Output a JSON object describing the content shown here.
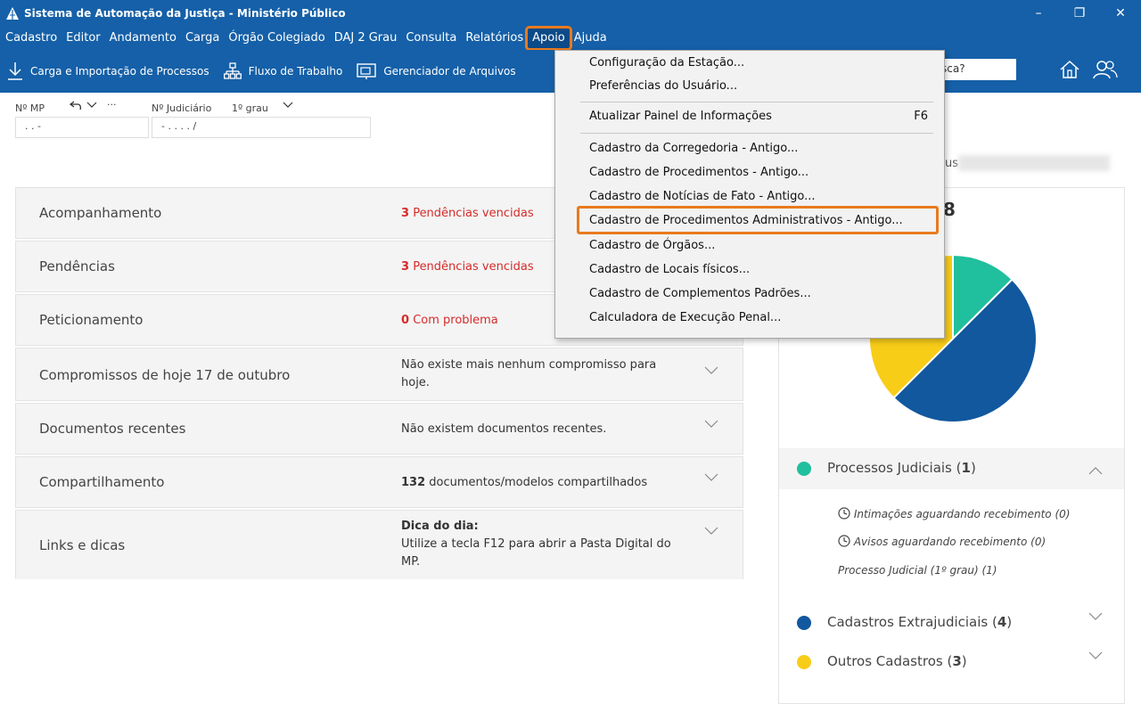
{
  "window": {
    "title": "Sistema de Automação da Justiça - Ministério Público",
    "minimize": "–",
    "restore": "❐",
    "close": "✕"
  },
  "menubar": {
    "items": [
      "Cadastro",
      "Editor",
      "Andamento",
      "Carga",
      "Órgão Colegiado",
      "DAJ 2 Grau",
      "Consulta",
      "Relatórios",
      "Apoio",
      "Ajuda"
    ],
    "active": "Apoio"
  },
  "toolbar": {
    "carga": "Carga e Importação de Processos",
    "fluxo": "Fluxo de Trabalho",
    "gerenciador": "Gerenciador de Arquivos",
    "search_text": "sca?"
  },
  "fields": {
    "nmp_label": "Nº MP",
    "nmp_value": ".   .      -",
    "history_extra": "···",
    "njud_label": "Nº Judiciário",
    "grau": "1º grau",
    "njud_value": "-   .   .   .   .   /"
  },
  "cards": [
    {
      "title": "Acompanhamento",
      "count": "3",
      "text": "Pendências vencidas"
    },
    {
      "title": "Pendências",
      "count": "3",
      "text": "Pendências vencidas"
    },
    {
      "title": "Peticionamento",
      "count": "0",
      "text": "Com problema"
    },
    {
      "title": "Compromissos de hoje 17 de outubro",
      "text": "Não existe mais nenhum compromisso para hoje."
    },
    {
      "title": "Documentos recentes",
      "text": "Não existem documentos recentes."
    },
    {
      "title": "Compartilhamento",
      "count": "132",
      "text": "documentos/modelos compartilhados"
    },
    {
      "title": "Links e dicas",
      "tip_title": "Dica do dia:",
      "text": "Utilize a tecla F12 para abrir a Pasta Digital do MP."
    }
  ],
  "right_panel": {
    "header_partial": "us",
    "total_partial": "8",
    "sections": [
      {
        "label": "Processos Judiciais",
        "count": "1",
        "color": "#20bf9d",
        "items": [
          "Intimações aguardando recebimento (0)",
          "Avisos aguardando recebimento (0)",
          "Processo Judicial (1º grau) (1)"
        ]
      },
      {
        "label": "Cadastros Extrajudiciais",
        "count": "4",
        "color": "#12589e"
      },
      {
        "label": "Outros Cadastros",
        "count": "3",
        "color": "#f8cd18"
      }
    ]
  },
  "chart_data": {
    "type": "pie",
    "categories": [
      "Processos Judiciais",
      "Cadastros Extrajudiciais",
      "Outros Cadastros"
    ],
    "values": [
      1,
      4,
      3
    ],
    "colors": [
      "#20bf9d",
      "#12589e",
      "#f8cd18"
    ]
  },
  "apoio_menu": {
    "items": [
      {
        "label": "Configuração da Estação..."
      },
      {
        "label": "Preferências do Usuário..."
      },
      {
        "label": "Atualizar Painel de Informações",
        "shortcut": "F6"
      },
      {
        "label": "Cadastro da Corregedoria - Antigo..."
      },
      {
        "label": "Cadastro de Procedimentos - Antigo..."
      },
      {
        "label": "Cadastro de Notícias de Fato - Antigo..."
      },
      {
        "label": "Cadastro de Procedimentos Administrativos - Antigo..."
      },
      {
        "label": "Cadastro de Órgãos..."
      },
      {
        "label": "Cadastro de Locais físicos..."
      },
      {
        "label": "Cadastro de Complementos Padrões..."
      },
      {
        "label": "Calculadora de Execução Penal..."
      }
    ],
    "highlighted": "Cadastro de Procedimentos Administrativos - Antigo..."
  }
}
